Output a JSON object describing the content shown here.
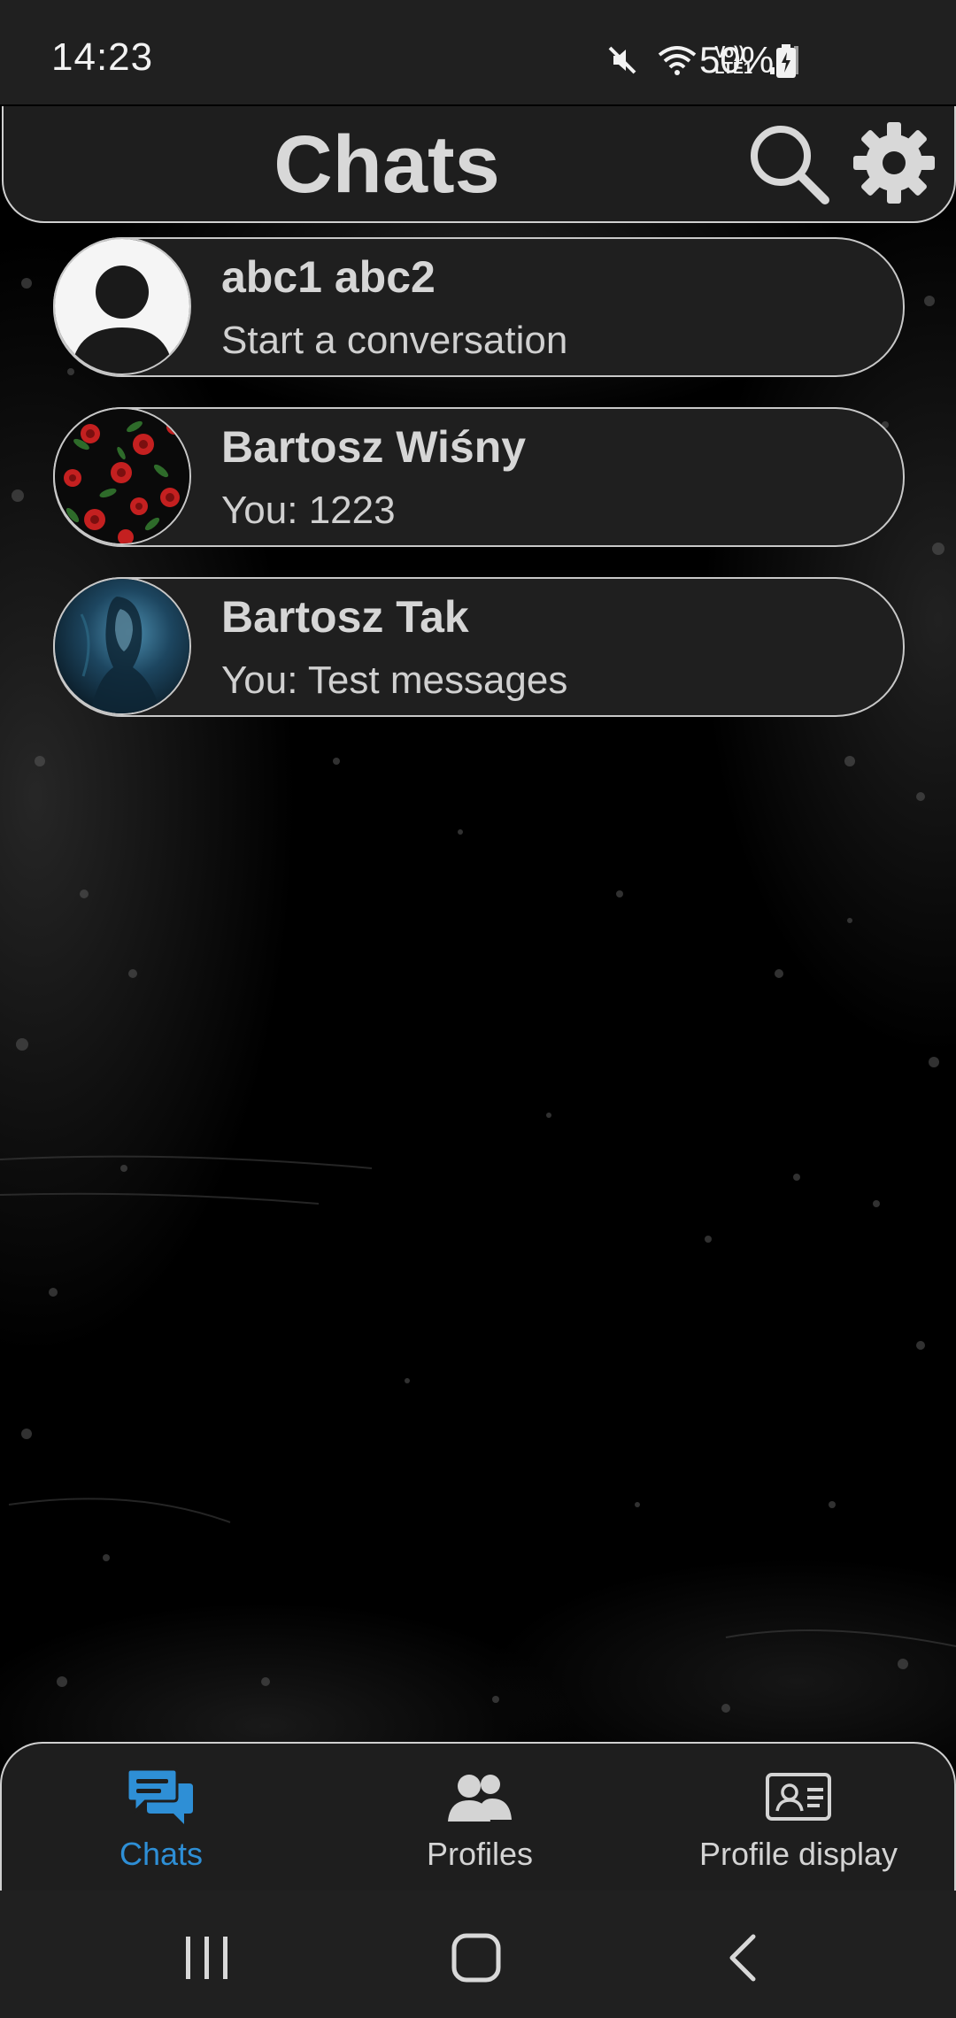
{
  "status_bar": {
    "time": "14:23",
    "battery": "50%",
    "network_label": "LTE1",
    "volte_label": "Vo))",
    "icons": [
      "mute-icon",
      "wifi-icon",
      "volte-icon",
      "signal-icon",
      "battery-charging-icon"
    ]
  },
  "header": {
    "title": "Chats",
    "search_icon": "search-icon",
    "settings_icon": "gear-icon"
  },
  "chats": [
    {
      "name": "abc1 abc2",
      "preview": "Start a conversation",
      "avatar": "default-person-avatar"
    },
    {
      "name": "Bartosz Wiśny",
      "preview": "You: 1223",
      "avatar": "roses-pattern-photo"
    },
    {
      "name": "Bartosz Tak",
      "preview": "You: Test messages",
      "avatar": "dark-blue-figure-photo"
    }
  ],
  "bottom_nav": {
    "items": [
      {
        "label": "Chats",
        "icon": "chat-bubbles-icon",
        "active": true
      },
      {
        "label": "Profiles",
        "icon": "people-icon",
        "active": false
      },
      {
        "label": "Profile display",
        "icon": "id-card-icon",
        "active": false
      }
    ]
  },
  "system_nav": {
    "buttons": [
      "recents-icon",
      "home-icon",
      "back-icon"
    ]
  },
  "colors": {
    "background": "#000000",
    "panel": "#1e1e1e",
    "border": "#cfcfcf",
    "accent": "#2e8fd6",
    "text": "#d6d6d6"
  }
}
